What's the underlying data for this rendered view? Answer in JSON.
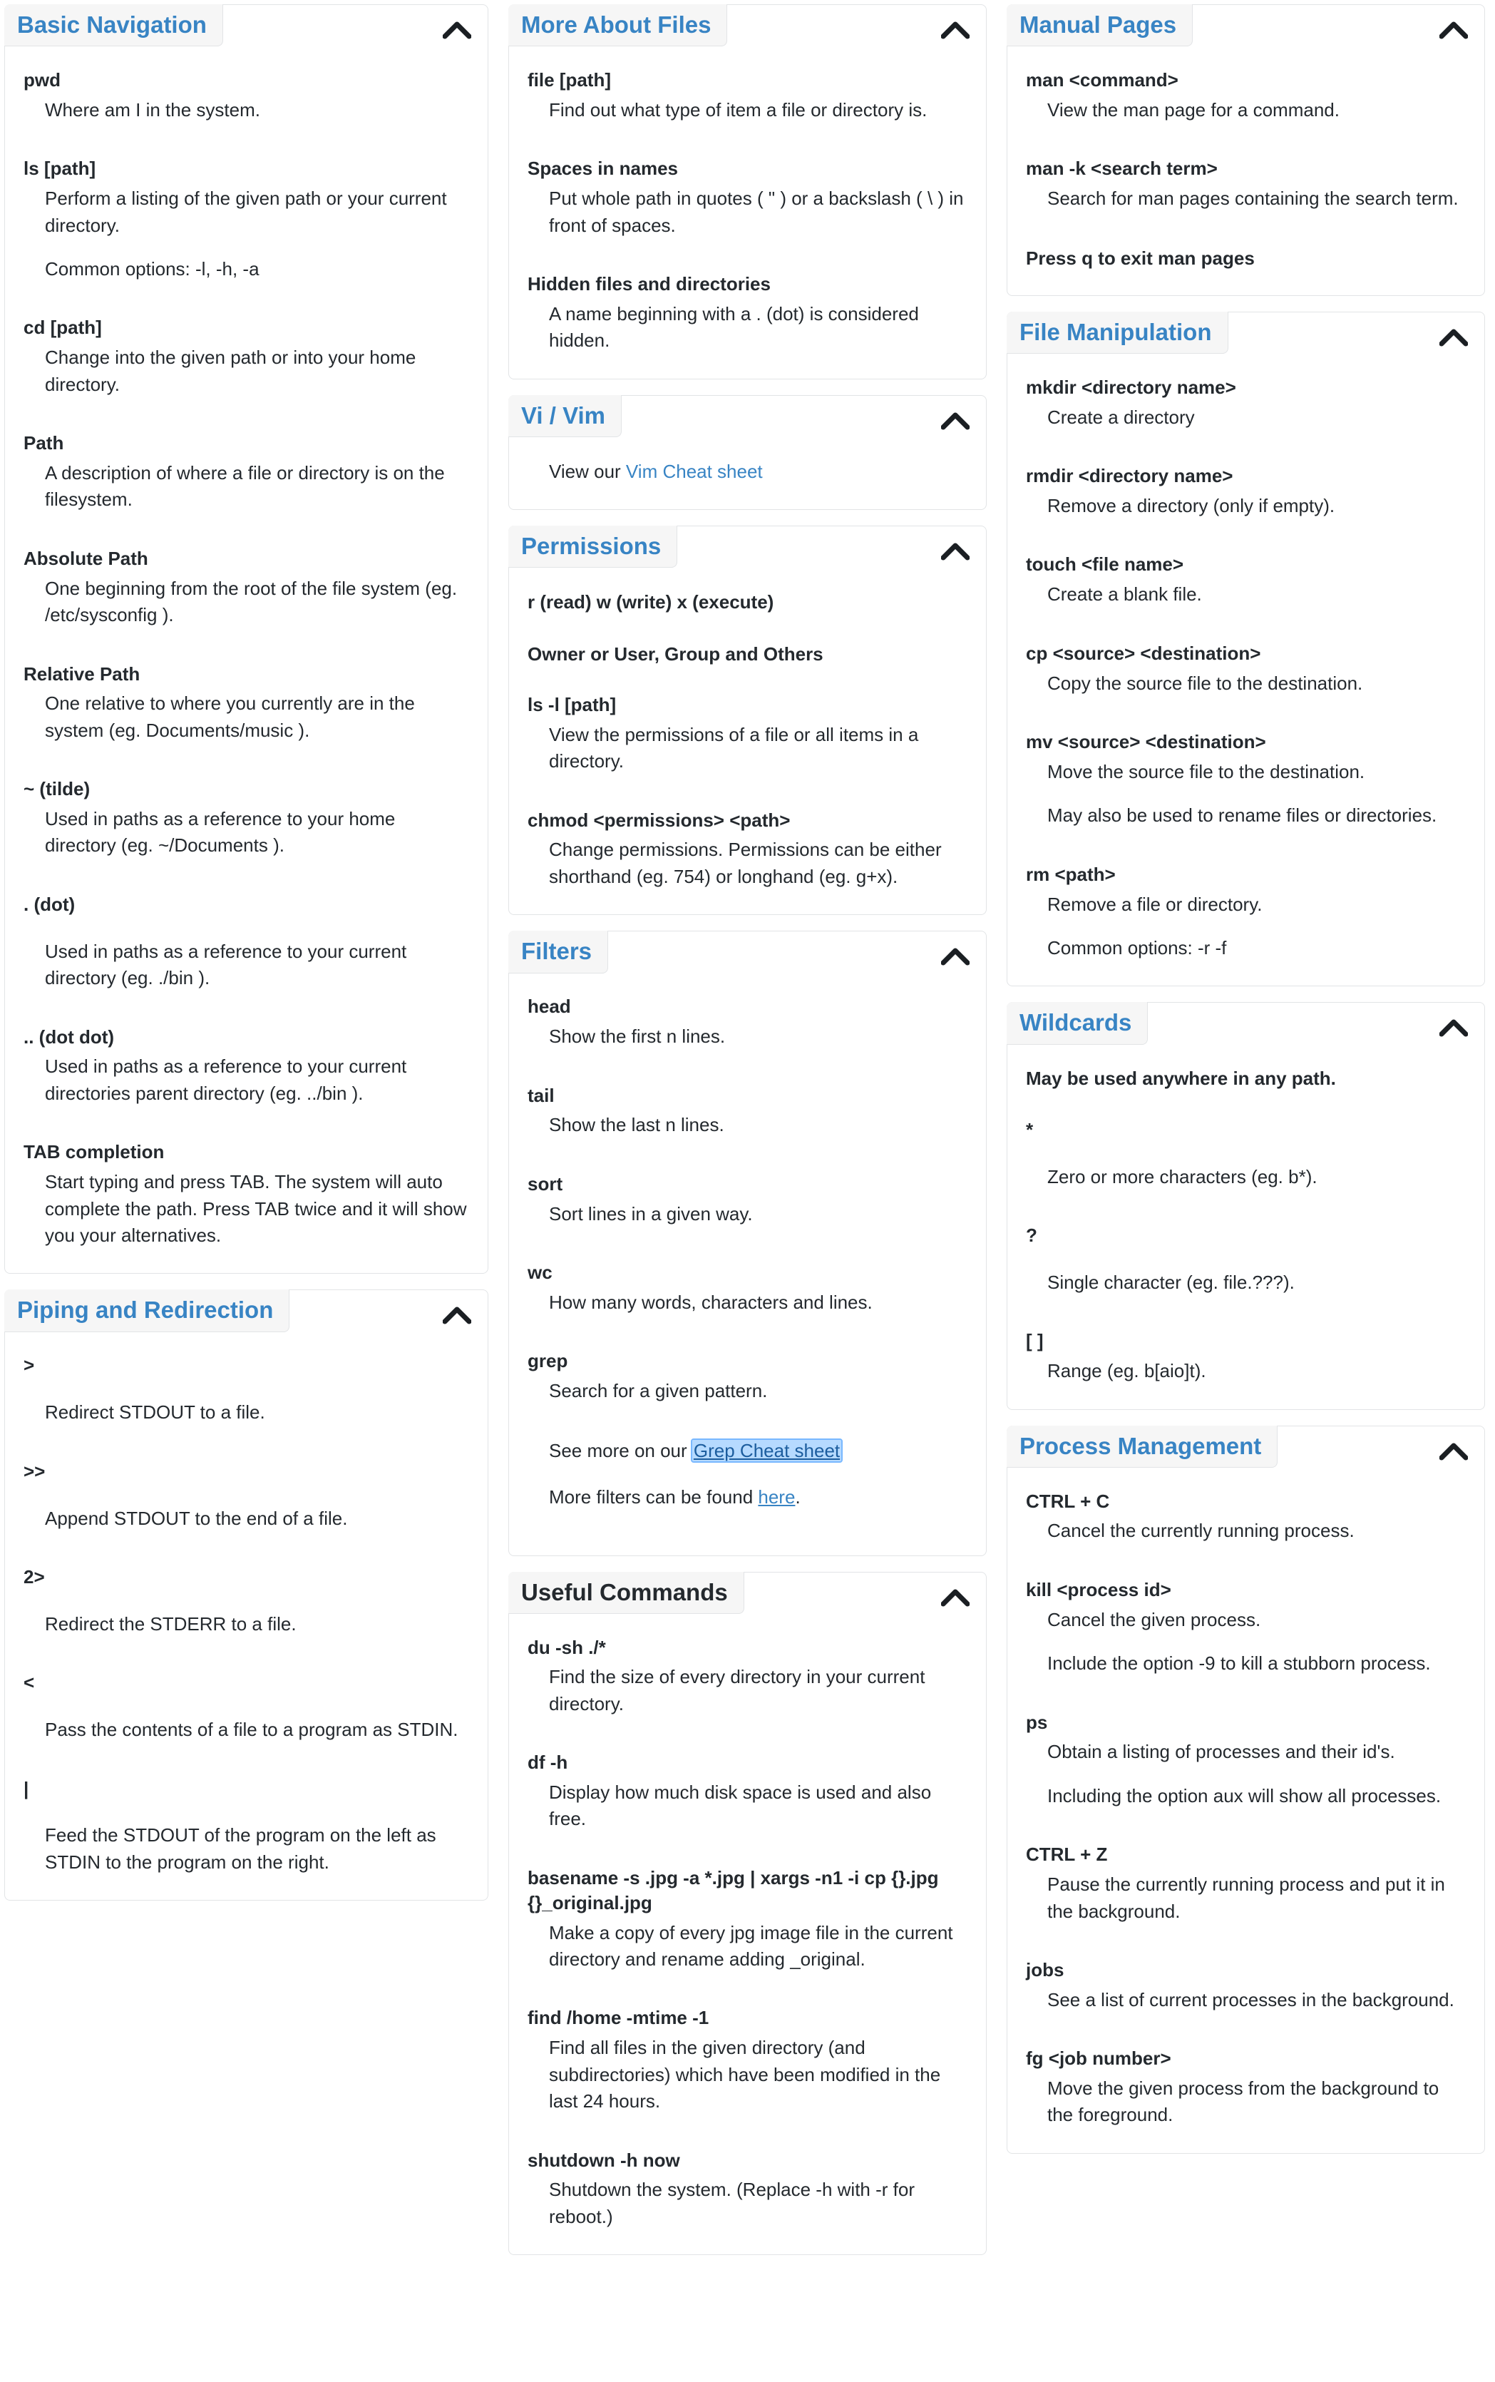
{
  "icons": {
    "collapse": "chevron-up-icon"
  },
  "colors": {
    "accent": "#3884c4",
    "panel_border": "#e2e4e6",
    "header_bg": "#f6f6f6",
    "link_focus_bg": "#b6daff"
  },
  "columns": [
    {
      "panels": [
        {
          "title": "Basic Navigation",
          "title_color": "accent",
          "entries": [
            {
              "term": "pwd",
              "descs": [
                "Where am I in the system."
              ]
            },
            {
              "term": "ls [path]",
              "descs": [
                "Perform a listing of the given path or your current directory.",
                "Common options: -l, -h, -a"
              ]
            },
            {
              "term": "cd [path]",
              "descs": [
                "Change into the given path or into your home directory."
              ]
            },
            {
              "term": "Path",
              "descs": [
                "A description of where a file or directory is on the filesystem."
              ]
            },
            {
              "term": "Absolute Path",
              "descs": [
                "One beginning from the root of the file system (eg. /etc/sysconfig )."
              ]
            },
            {
              "term": "Relative Path",
              "descs": [
                "One relative to where you currently are in the system (eg. Documents/music )."
              ]
            },
            {
              "term": "~ (tilde)",
              "descs": [
                "Used in paths as a reference to your home directory (eg. ~/Documents )."
              ]
            },
            {
              "term": ". (dot)",
              "gap": true,
              "descs": [
                "Used in paths as a reference to your current directory (eg. ./bin )."
              ]
            },
            {
              "term": ".. (dot dot)",
              "descs": [
                "Used in paths as a reference to your current directories parent directory (eg. ../bin )."
              ]
            },
            {
              "term": "TAB completion",
              "descs": [
                "Start typing and press TAB. The system will auto complete the path. Press TAB twice and it will show you your alternatives."
              ]
            }
          ]
        },
        {
          "title": "Piping and Redirection",
          "title_color": "accent",
          "entries": [
            {
              "term": ">",
              "gap": true,
              "descs": [
                "Redirect STDOUT to a file."
              ]
            },
            {
              "term": ">>",
              "gap": true,
              "descs": [
                "Append STDOUT to the end of a file."
              ]
            },
            {
              "term": "2>",
              "gap": true,
              "descs": [
                "Redirect the STDERR to a file."
              ]
            },
            {
              "term": "<",
              "gap": true,
              "descs": [
                "Pass the contents of a file to a program as STDIN."
              ]
            },
            {
              "term": "|",
              "gap": true,
              "descs": [
                "Feed the STDOUT of the program on the left as STDIN to the program on the right."
              ]
            }
          ]
        }
      ]
    },
    {
      "panels": [
        {
          "title": "More About Files",
          "title_color": "accent",
          "entries": [
            {
              "term": "file [path]",
              "descs": [
                "Find out what type of item a file or directory is."
              ]
            },
            {
              "term": "Spaces in names",
              "descs": [
                "Put whole path in quotes ( \" ) or a backslash ( \\ ) in front of spaces."
              ]
            },
            {
              "term": "Hidden files and directories",
              "descs": [
                "A name beginning with a . (dot) is considered hidden."
              ]
            }
          ]
        },
        {
          "title": "Vi / Vim",
          "title_color": "accent",
          "link_line": {
            "prefix": "View our ",
            "link": "Vim Cheat sheet",
            "suffix": ""
          }
        },
        {
          "title": "Permissions",
          "title_color": "accent",
          "bold_lines": [
            "r (read) w (write) x (execute)",
            "Owner or User, Group and Others"
          ],
          "entries": [
            {
              "term": "ls -l [path]",
              "descs": [
                "View the permissions of a file or all items in a directory."
              ]
            },
            {
              "term": "chmod <permissions> <path>",
              "descs": [
                "Change permissions. Permissions can be either shorthand (eg. 754) or longhand (eg. g+x)."
              ]
            }
          ]
        },
        {
          "title": "Filters",
          "title_color": "accent",
          "entries": [
            {
              "term": "head",
              "descs": [
                "Show the first n lines."
              ]
            },
            {
              "term": "tail",
              "descs": [
                "Show the last n lines."
              ]
            },
            {
              "term": "sort",
              "descs": [
                "Sort lines in a given way."
              ]
            },
            {
              "term": "wc",
              "descs": [
                "How many words, characters and lines."
              ]
            },
            {
              "term": "grep",
              "descs": [
                "Search for a given pattern."
              ]
            }
          ],
          "footer_links": [
            {
              "prefix": "See more on our ",
              "link": "Grep Cheat sheet",
              "suffix": "",
              "focused": true
            },
            {
              "prefix": "More filters can be found ",
              "link": "here",
              "suffix": ".",
              "focused": false
            }
          ]
        },
        {
          "title": "Useful Commands",
          "title_color": "dark",
          "entries": [
            {
              "term": "du -sh ./*",
              "descs": [
                "Find the size of every directory in your current directory."
              ]
            },
            {
              "term": "df -h",
              "descs": [
                "Display how much disk space is used and also free."
              ]
            },
            {
              "term": "basename -s .jpg -a *.jpg | xargs -n1 -i cp {}.jpg {}_original.jpg",
              "descs": [
                "Make a copy of every jpg image file in the current directory and rename adding _original."
              ]
            },
            {
              "term": "find /home -mtime -1",
              "descs": [
                "Find all files in the given directory (and subdirectories) which have been modified in the last 24 hours."
              ]
            },
            {
              "term": "shutdown -h now",
              "descs": [
                "Shutdown the system. (Replace -h with -r for reboot.)"
              ]
            }
          ]
        }
      ]
    },
    {
      "panels": [
        {
          "title": "Manual Pages",
          "title_color": "accent",
          "entries": [
            {
              "term": "man <command>",
              "descs": [
                "View the man page for a command."
              ]
            },
            {
              "term": "man -k <search term>",
              "descs": [
                "Search for man pages containing the search term."
              ]
            }
          ],
          "bold_footer": [
            "Press q to exit man pages"
          ]
        },
        {
          "title": "File Manipulation",
          "title_color": "accent",
          "entries": [
            {
              "term": "mkdir <directory name>",
              "descs": [
                "Create a directory"
              ]
            },
            {
              "term": "rmdir <directory name>",
              "descs": [
                "Remove a directory (only if empty)."
              ]
            },
            {
              "term": "touch <file name>",
              "descs": [
                "Create a blank file."
              ]
            },
            {
              "term": "cp <source> <destination>",
              "descs": [
                "Copy the source file to the destination."
              ]
            },
            {
              "term": "mv <source> <destination>",
              "descs": [
                "Move the source file to the destination.",
                "May also be used to rename files or directories."
              ]
            },
            {
              "term": "rm <path>",
              "descs": [
                "Remove a file or directory.",
                "Common options: -r -f"
              ]
            }
          ]
        },
        {
          "title": "Wildcards",
          "title_color": "accent",
          "bold_lines": [
            "May be used anywhere in any path."
          ],
          "entries": [
            {
              "term": "*",
              "gap": true,
              "descs": [
                "Zero or more characters (eg. b*)."
              ]
            },
            {
              "term": "?",
              "gap": true,
              "descs": [
                "Single character (eg. file.???)."
              ]
            },
            {
              "term": "[ ]",
              "descs": [
                "Range (eg. b[aio]t)."
              ]
            }
          ]
        },
        {
          "title": "Process Management",
          "title_color": "accent",
          "entries": [
            {
              "term": "CTRL + C",
              "descs": [
                "Cancel the currently running process."
              ]
            },
            {
              "term": "kill <process id>",
              "descs": [
                "Cancel the given process.",
                "Include the option -9 to kill a stubborn process."
              ]
            },
            {
              "term": "ps",
              "descs": [
                "Obtain a listing of processes and their id's.",
                "Including the option aux will show all processes."
              ]
            },
            {
              "term": "CTRL + Z",
              "descs": [
                "Pause the currently running process and put it in the background."
              ]
            },
            {
              "term": "jobs",
              "descs": [
                "See a list of current processes in the background."
              ]
            },
            {
              "term": "fg <job number>",
              "descs": [
                "Move the given process from the background to the foreground."
              ]
            }
          ]
        }
      ]
    }
  ]
}
